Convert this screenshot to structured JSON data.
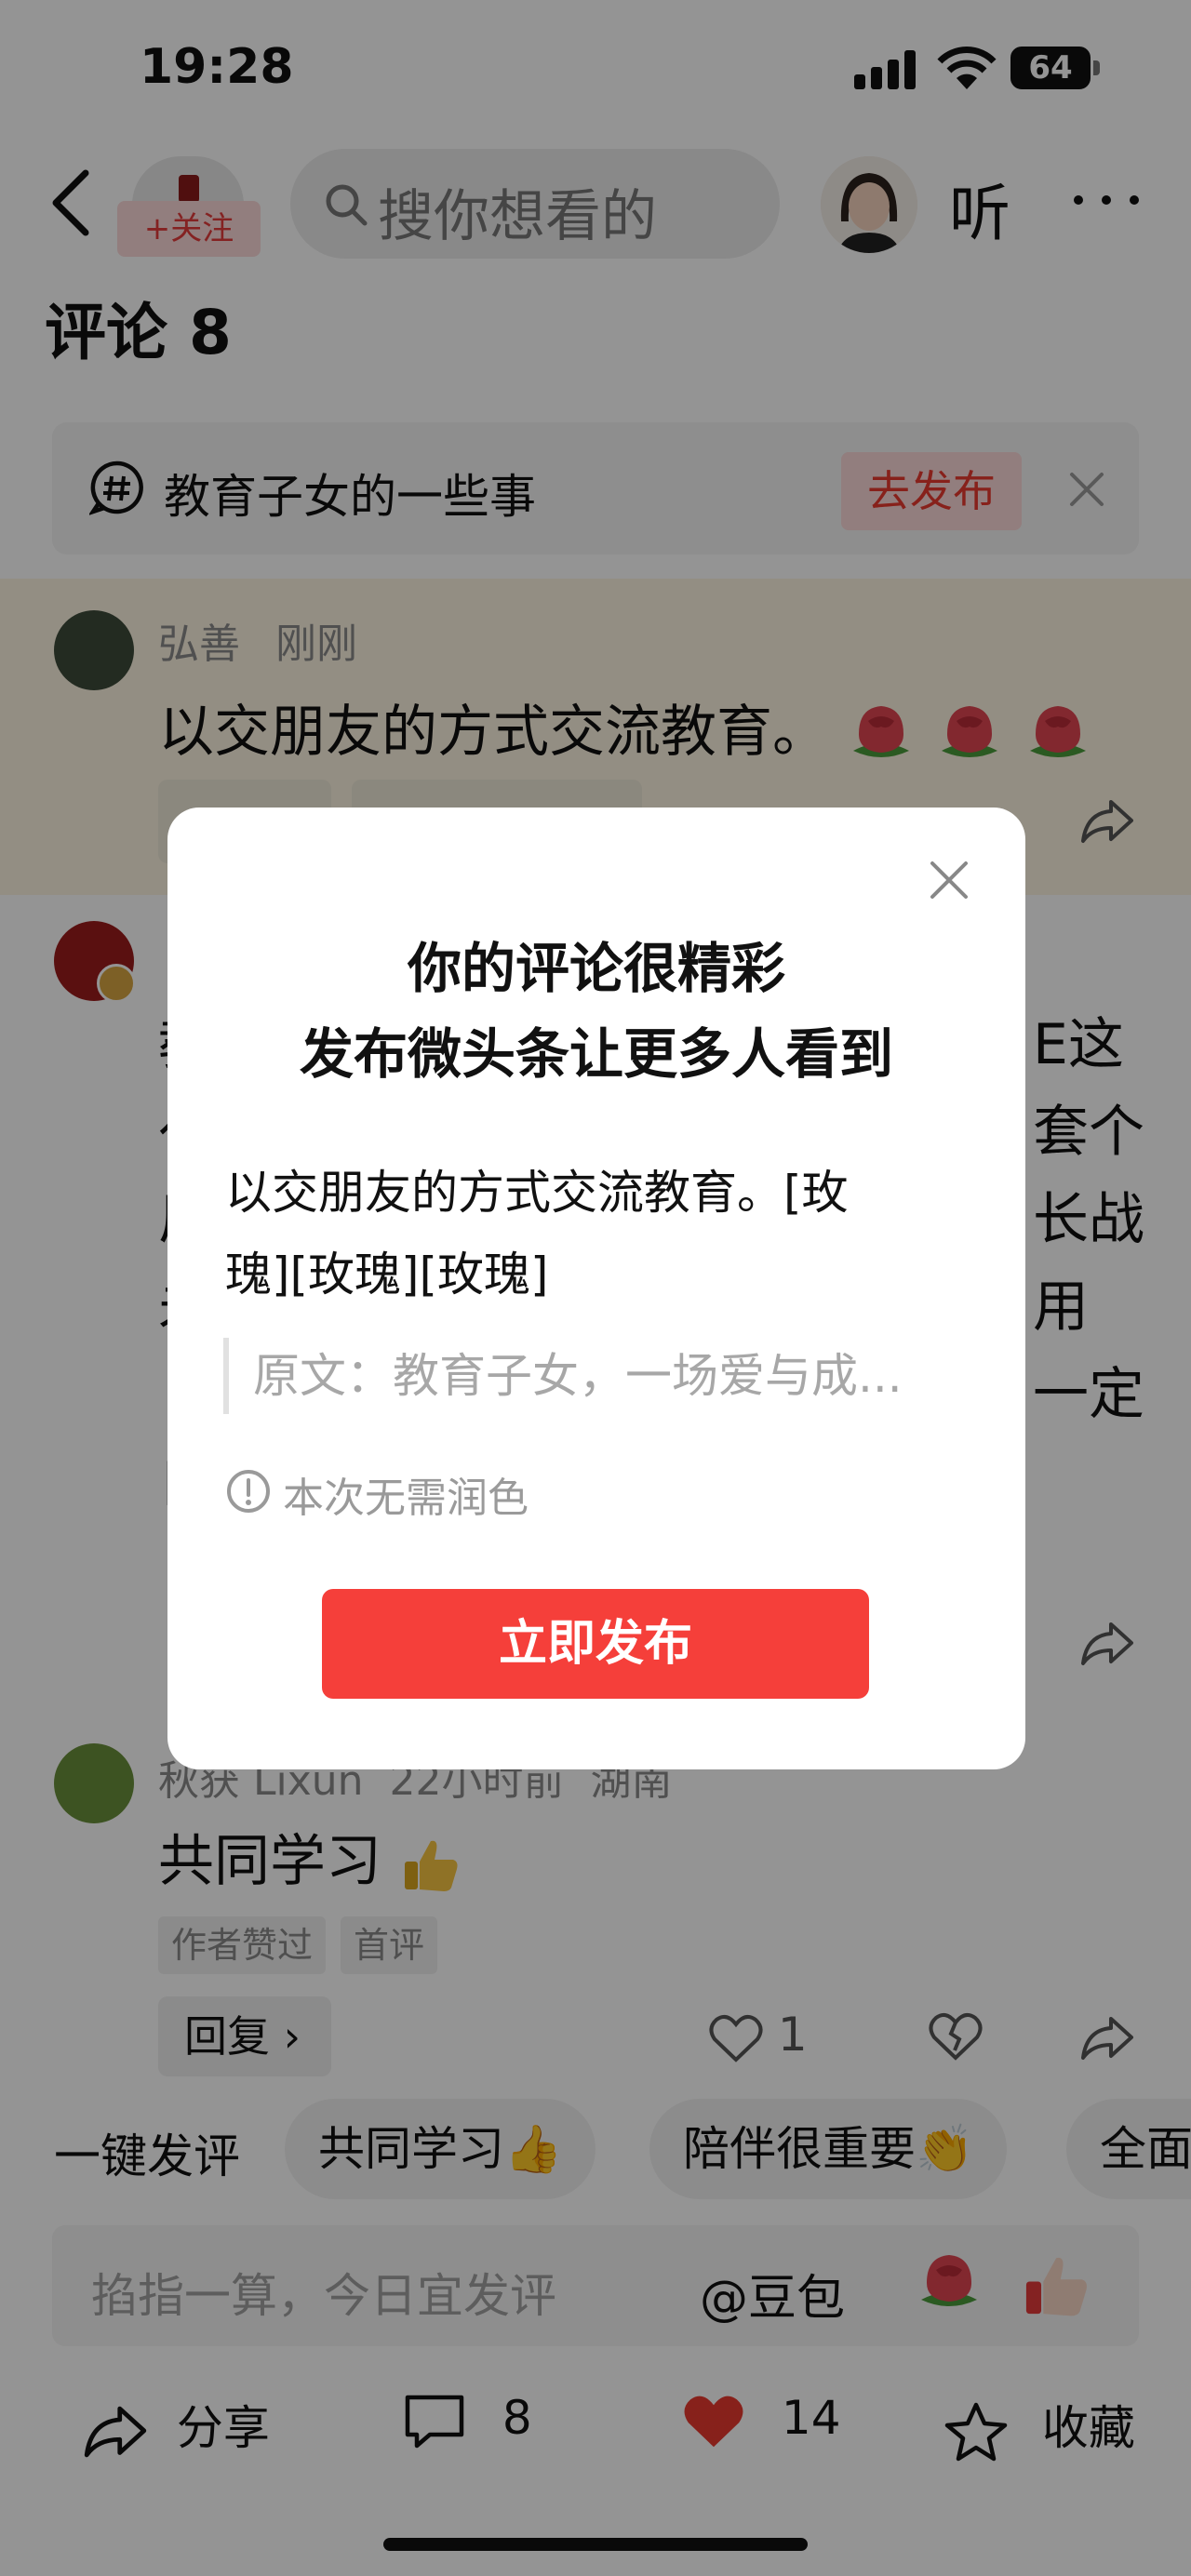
{
  "status_bar": {
    "time": "19:28",
    "battery": "64"
  },
  "header": {
    "follow_label": "+关注",
    "search_placeholder": "搜你想看的",
    "listen_label": "听"
  },
  "comments": {
    "title": "评论 8",
    "topic_bar": {
      "topic": "教育子女的一些事",
      "publish_label": "去发布"
    },
    "items": [
      {
        "username": "弘善",
        "time": "刚刚",
        "text": "以交朋友的方式交流教育。",
        "emoji": [
          "rose",
          "rose",
          "rose"
        ]
      },
      {
        "visible_left_chars": [
          "教",
          "亻",
          "厂",
          "未",
          "彳",
          "自"
        ],
        "visible_right_text": [
          "E这",
          "套个",
          "长战",
          "用",
          "一定"
        ]
      },
      {
        "username": "秋获 Lixun",
        "time": "22小时前",
        "location": "湖南",
        "text": "共同学习",
        "emoji": "thumbs-up",
        "tags": [
          "作者赞过",
          "首评"
        ],
        "reply_label": "回复",
        "like_count": "1"
      }
    ]
  },
  "quick_replies": {
    "label": "一键发评",
    "chips": [
      "共同学习",
      "陪伴很重要",
      "全面"
    ]
  },
  "input_bar": {
    "placeholder": "掐指一算，今日宜发评",
    "at_doubao": "@豆包"
  },
  "bottom_bar": {
    "share_label": "分享",
    "comment_count": "8",
    "like_count": "14",
    "favorite_label": "收藏"
  },
  "dialog": {
    "title_line1": "你的评论很精彩",
    "title_line2": "发布微头条让更多人看到",
    "body_line1": "以交朋友的方式交流教育。[玫",
    "body_line2": "瑰][玫瑰][玫瑰]",
    "quote": "原文：教育子女，一场爱与成...",
    "note": "本次无需润色",
    "publish_button": "立即发布"
  },
  "colors": {
    "accent_red": "#f53f3a",
    "like_red": "#e8392f",
    "highlight_bg": "#fdf4e2"
  }
}
